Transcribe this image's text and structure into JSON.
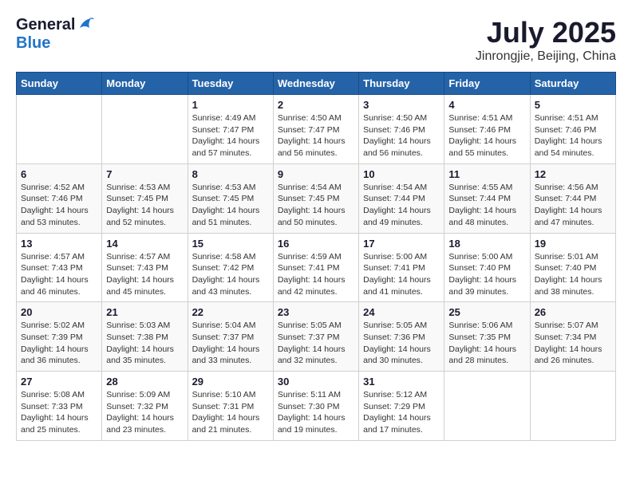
{
  "logo": {
    "general": "General",
    "blue": "Blue"
  },
  "title": "July 2025",
  "subtitle": "Jinrongjie, Beijing, China",
  "days_of_week": [
    "Sunday",
    "Monday",
    "Tuesday",
    "Wednesday",
    "Thursday",
    "Friday",
    "Saturday"
  ],
  "weeks": [
    [
      {
        "day": "",
        "info": ""
      },
      {
        "day": "",
        "info": ""
      },
      {
        "day": "1",
        "info": "Sunrise: 4:49 AM\nSunset: 7:47 PM\nDaylight: 14 hours and 57 minutes."
      },
      {
        "day": "2",
        "info": "Sunrise: 4:50 AM\nSunset: 7:47 PM\nDaylight: 14 hours and 56 minutes."
      },
      {
        "day": "3",
        "info": "Sunrise: 4:50 AM\nSunset: 7:46 PM\nDaylight: 14 hours and 56 minutes."
      },
      {
        "day": "4",
        "info": "Sunrise: 4:51 AM\nSunset: 7:46 PM\nDaylight: 14 hours and 55 minutes."
      },
      {
        "day": "5",
        "info": "Sunrise: 4:51 AM\nSunset: 7:46 PM\nDaylight: 14 hours and 54 minutes."
      }
    ],
    [
      {
        "day": "6",
        "info": "Sunrise: 4:52 AM\nSunset: 7:46 PM\nDaylight: 14 hours and 53 minutes."
      },
      {
        "day": "7",
        "info": "Sunrise: 4:53 AM\nSunset: 7:45 PM\nDaylight: 14 hours and 52 minutes."
      },
      {
        "day": "8",
        "info": "Sunrise: 4:53 AM\nSunset: 7:45 PM\nDaylight: 14 hours and 51 minutes."
      },
      {
        "day": "9",
        "info": "Sunrise: 4:54 AM\nSunset: 7:45 PM\nDaylight: 14 hours and 50 minutes."
      },
      {
        "day": "10",
        "info": "Sunrise: 4:54 AM\nSunset: 7:44 PM\nDaylight: 14 hours and 49 minutes."
      },
      {
        "day": "11",
        "info": "Sunrise: 4:55 AM\nSunset: 7:44 PM\nDaylight: 14 hours and 48 minutes."
      },
      {
        "day": "12",
        "info": "Sunrise: 4:56 AM\nSunset: 7:44 PM\nDaylight: 14 hours and 47 minutes."
      }
    ],
    [
      {
        "day": "13",
        "info": "Sunrise: 4:57 AM\nSunset: 7:43 PM\nDaylight: 14 hours and 46 minutes."
      },
      {
        "day": "14",
        "info": "Sunrise: 4:57 AM\nSunset: 7:43 PM\nDaylight: 14 hours and 45 minutes."
      },
      {
        "day": "15",
        "info": "Sunrise: 4:58 AM\nSunset: 7:42 PM\nDaylight: 14 hours and 43 minutes."
      },
      {
        "day": "16",
        "info": "Sunrise: 4:59 AM\nSunset: 7:41 PM\nDaylight: 14 hours and 42 minutes."
      },
      {
        "day": "17",
        "info": "Sunrise: 5:00 AM\nSunset: 7:41 PM\nDaylight: 14 hours and 41 minutes."
      },
      {
        "day": "18",
        "info": "Sunrise: 5:00 AM\nSunset: 7:40 PM\nDaylight: 14 hours and 39 minutes."
      },
      {
        "day": "19",
        "info": "Sunrise: 5:01 AM\nSunset: 7:40 PM\nDaylight: 14 hours and 38 minutes."
      }
    ],
    [
      {
        "day": "20",
        "info": "Sunrise: 5:02 AM\nSunset: 7:39 PM\nDaylight: 14 hours and 36 minutes."
      },
      {
        "day": "21",
        "info": "Sunrise: 5:03 AM\nSunset: 7:38 PM\nDaylight: 14 hours and 35 minutes."
      },
      {
        "day": "22",
        "info": "Sunrise: 5:04 AM\nSunset: 7:37 PM\nDaylight: 14 hours and 33 minutes."
      },
      {
        "day": "23",
        "info": "Sunrise: 5:05 AM\nSunset: 7:37 PM\nDaylight: 14 hours and 32 minutes."
      },
      {
        "day": "24",
        "info": "Sunrise: 5:05 AM\nSunset: 7:36 PM\nDaylight: 14 hours and 30 minutes."
      },
      {
        "day": "25",
        "info": "Sunrise: 5:06 AM\nSunset: 7:35 PM\nDaylight: 14 hours and 28 minutes."
      },
      {
        "day": "26",
        "info": "Sunrise: 5:07 AM\nSunset: 7:34 PM\nDaylight: 14 hours and 26 minutes."
      }
    ],
    [
      {
        "day": "27",
        "info": "Sunrise: 5:08 AM\nSunset: 7:33 PM\nDaylight: 14 hours and 25 minutes."
      },
      {
        "day": "28",
        "info": "Sunrise: 5:09 AM\nSunset: 7:32 PM\nDaylight: 14 hours and 23 minutes."
      },
      {
        "day": "29",
        "info": "Sunrise: 5:10 AM\nSunset: 7:31 PM\nDaylight: 14 hours and 21 minutes."
      },
      {
        "day": "30",
        "info": "Sunrise: 5:11 AM\nSunset: 7:30 PM\nDaylight: 14 hours and 19 minutes."
      },
      {
        "day": "31",
        "info": "Sunrise: 5:12 AM\nSunset: 7:29 PM\nDaylight: 14 hours and 17 minutes."
      },
      {
        "day": "",
        "info": ""
      },
      {
        "day": "",
        "info": ""
      }
    ]
  ]
}
